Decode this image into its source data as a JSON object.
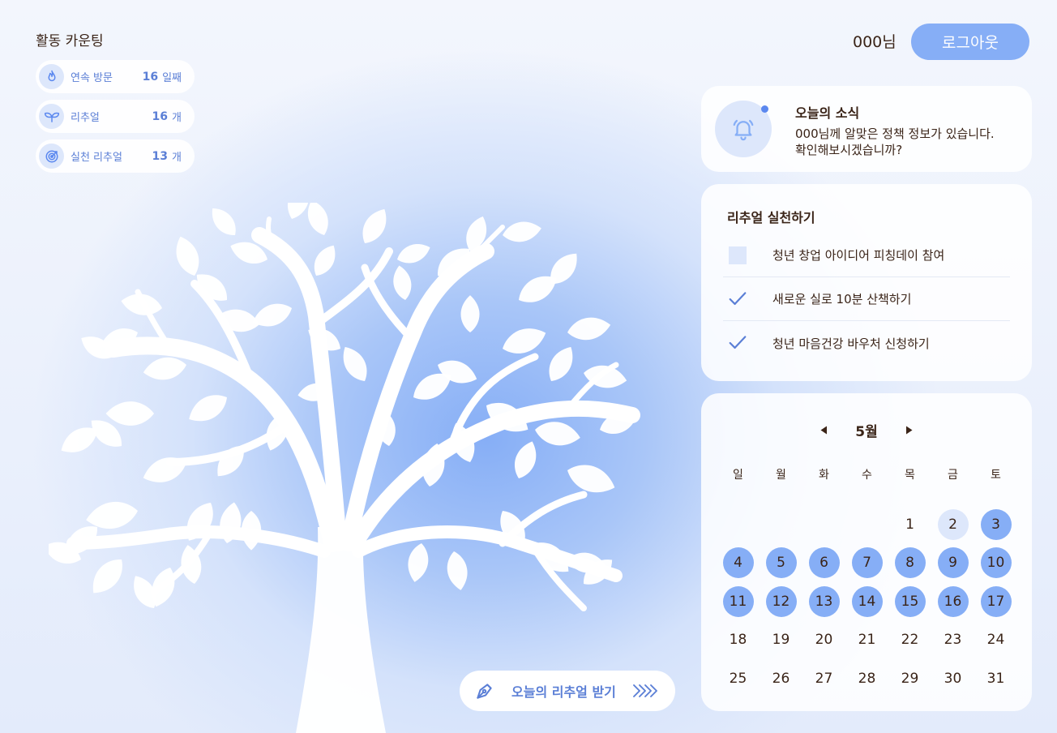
{
  "activity": {
    "title": "활동 카운팅",
    "stats": [
      {
        "label": "연속 방문",
        "value": "16",
        "unit": "일째",
        "icon": "flame-icon"
      },
      {
        "label": "리추얼",
        "value": "16",
        "unit": "개",
        "icon": "sprout-icon"
      },
      {
        "label": "실천 리추얼",
        "value": "13",
        "unit": "개",
        "icon": "target-icon"
      }
    ]
  },
  "header": {
    "user": "000님",
    "logout_label": "로그아웃"
  },
  "news": {
    "title": "오늘의 소식",
    "line1": "000님께 알맞은 정책 정보가 있습니다.",
    "line2": "확인해보시겠습니까?",
    "icon": "bell-icon"
  },
  "todo": {
    "title": "리추얼 실천하기",
    "items": [
      {
        "text": "청년 창업 아이디어 피칭데이 참여",
        "checked": false
      },
      {
        "text": "새로운 실로 10분 산책하기",
        "checked": true
      },
      {
        "text": "청년 마음건강 바우처 신청하기",
        "checked": true
      }
    ]
  },
  "calendar": {
    "month_label": "5월",
    "weekdays": [
      "일",
      "월",
      "화",
      "수",
      "목",
      "금",
      "토"
    ],
    "first_weekday_index": 4,
    "days_in_month": 31,
    "today": 2,
    "visited_days": [
      3,
      4,
      5,
      6,
      7,
      8,
      9,
      10,
      11,
      12,
      13,
      14,
      15,
      16,
      17
    ]
  },
  "reminder": {
    "label": "오늘의 리추얼 받기",
    "icon": "pen-nib-icon"
  },
  "colors": {
    "accent": "#86aef6",
    "accent_text": "#5b7fd6",
    "light_accent": "#dde7fb",
    "text": "#3a2418"
  }
}
